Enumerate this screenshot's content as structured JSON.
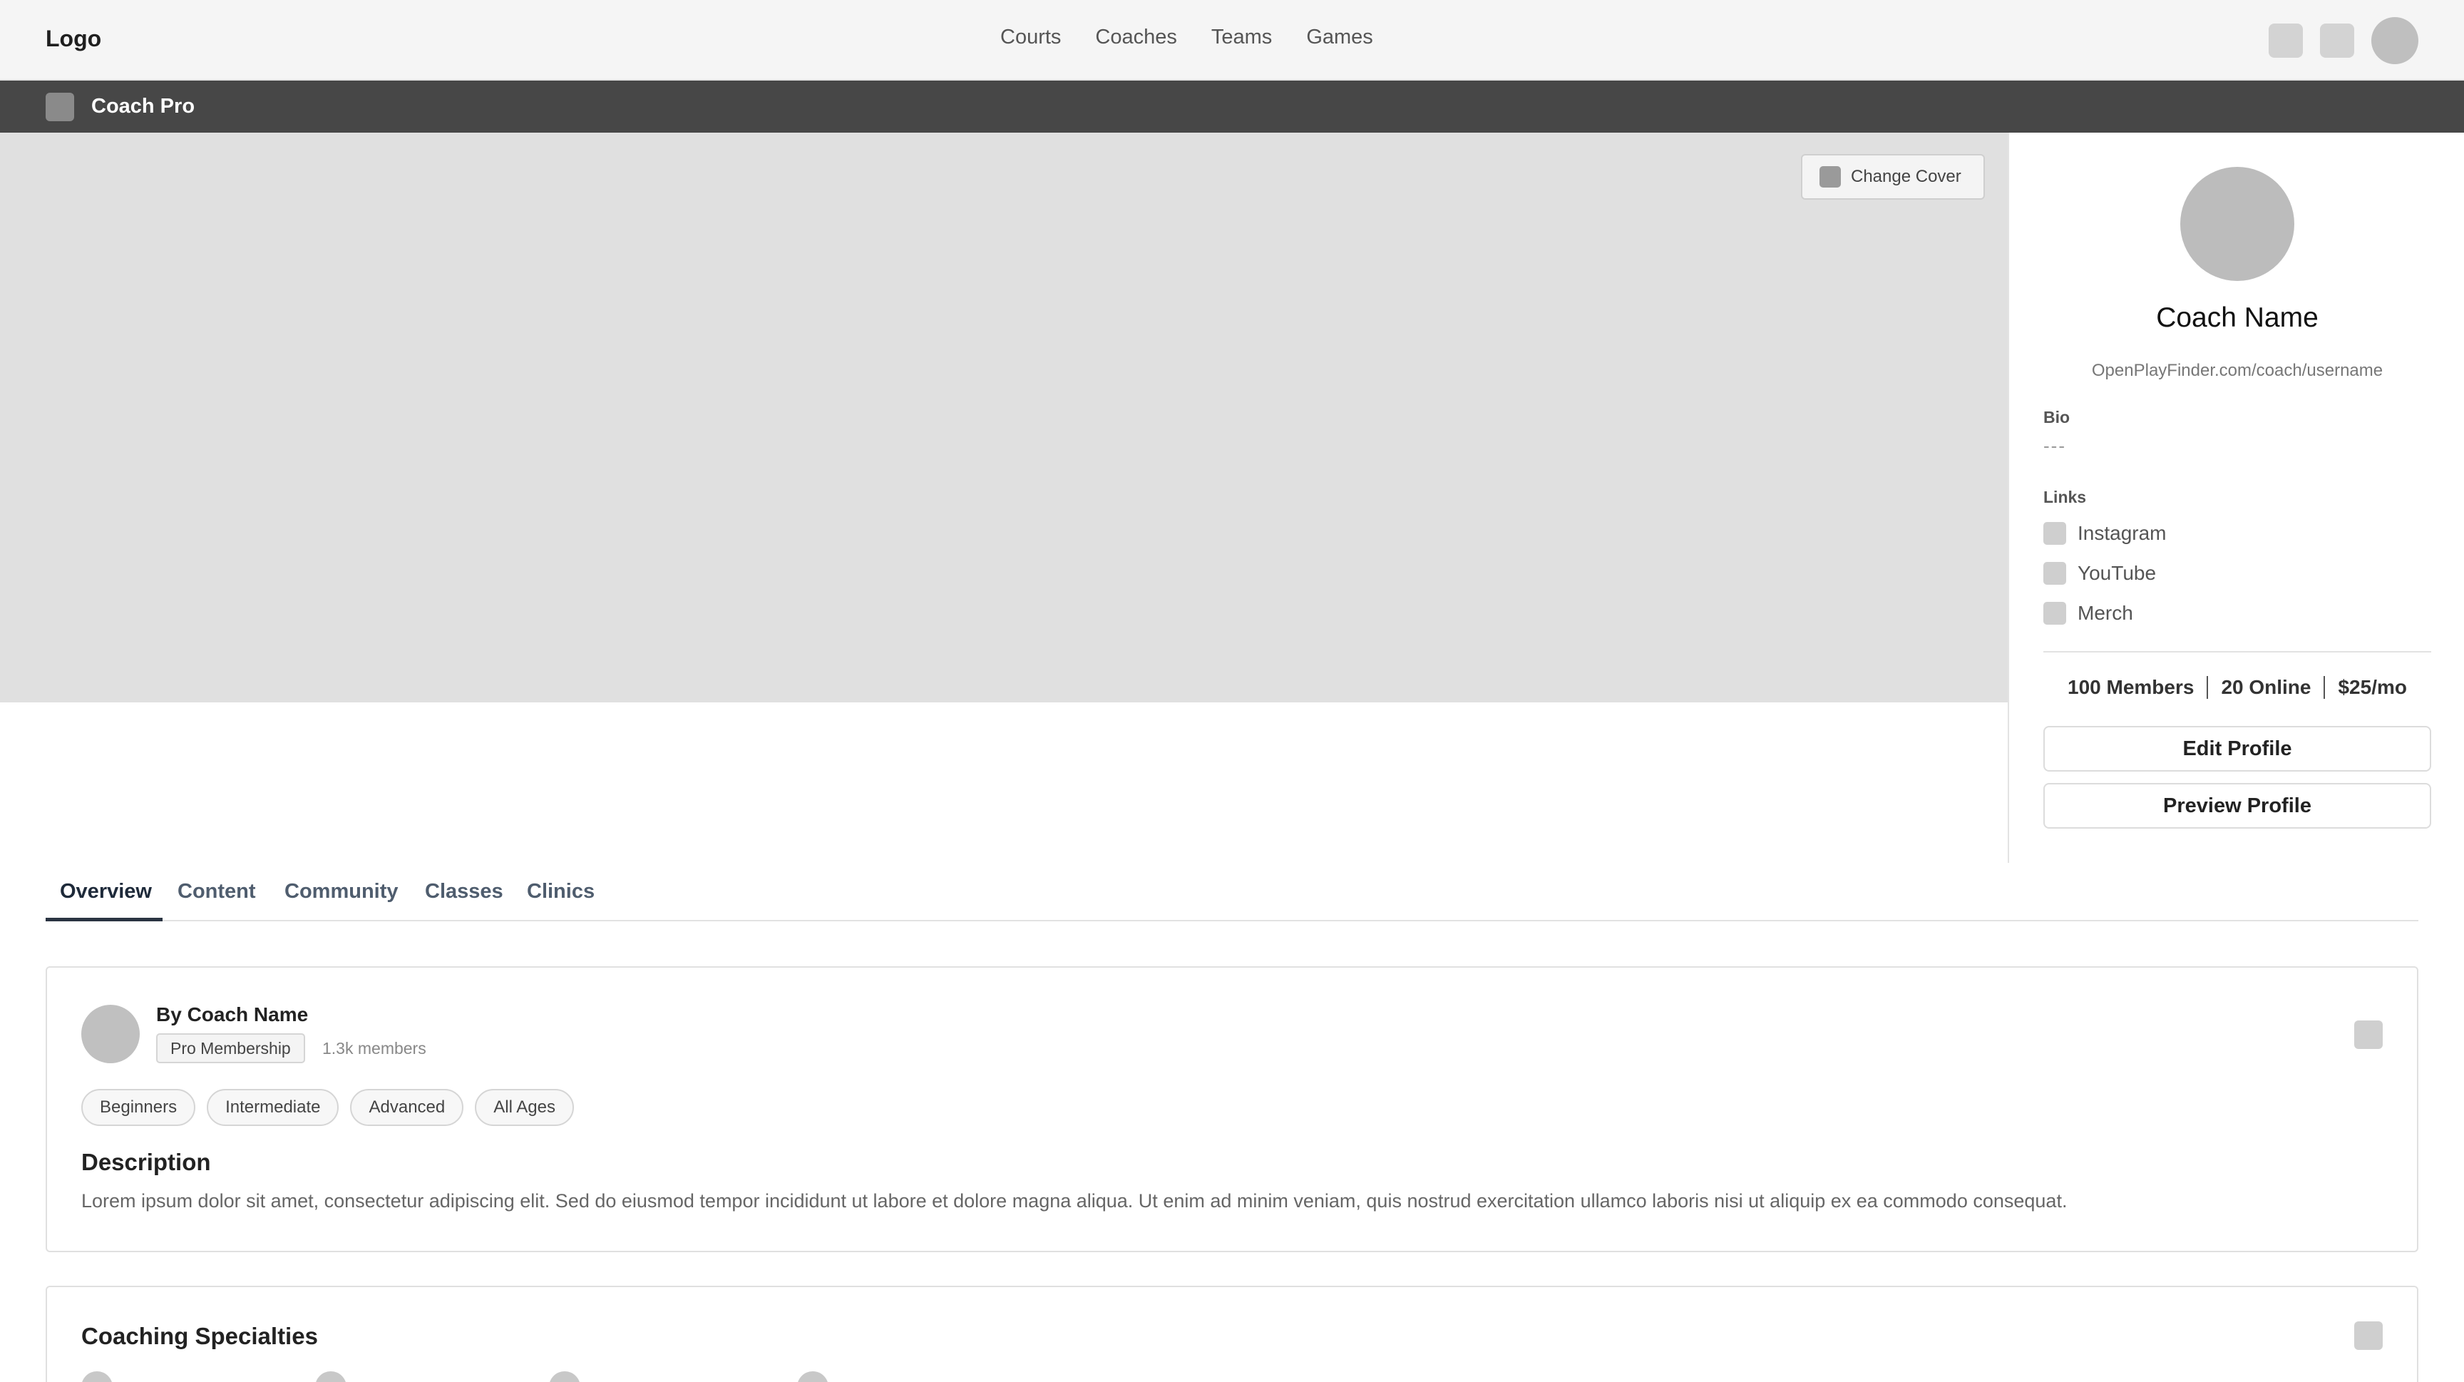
{
  "topnav": {
    "logo": "Logo",
    "links": [
      "Courts",
      "Coaches",
      "Teams",
      "Games"
    ],
    "icons": [
      "square-icon",
      "square-icon",
      "user-avatar"
    ]
  },
  "subbar": {
    "title": "Coach Pro",
    "icon": "app-icon"
  },
  "cover": {
    "change_cover_label": "Change Cover"
  },
  "profile": {
    "name": "Coach Name",
    "url": "OpenPlayFinder.com/coach/username",
    "bio_label": "Bio",
    "bio_text": "---",
    "links_label": "Links",
    "links": [
      "Instagram",
      "YouTube",
      "Merch"
    ],
    "stats": [
      "100 Members",
      "20 Online",
      "$25/mo"
    ],
    "edit_button": "Edit Profile",
    "preview_button": "Preview Profile"
  },
  "tabs": [
    "Overview",
    "Content",
    "Community",
    "Classes",
    "Clinics"
  ],
  "overview": {
    "by_line": "By Coach Name",
    "membership": "Pro Membership",
    "members_count": "1.3k members",
    "levels": [
      "Beginners",
      "Intermediate",
      "Advanced",
      "All Ages"
    ],
    "description_title": "Description",
    "description_text": "Lorem ipsum dolor sit amet, consectetur adipiscing elit. Sed do eiusmod tempor incididunt ut labore et dolore magna aliqua. Ut enim ad minim veniam, quis nostrud exercitation ullamco laboris nisi ut aliquip ex ea commodo consequat."
  },
  "specialties": {
    "title": "Coaching Specialties"
  },
  "colors": {
    "nav_bg": "#f5f5f5",
    "subbar_bg": "#474747",
    "cover_bg": "#e0e0e0",
    "tab_active": "#1e2a3a"
  }
}
